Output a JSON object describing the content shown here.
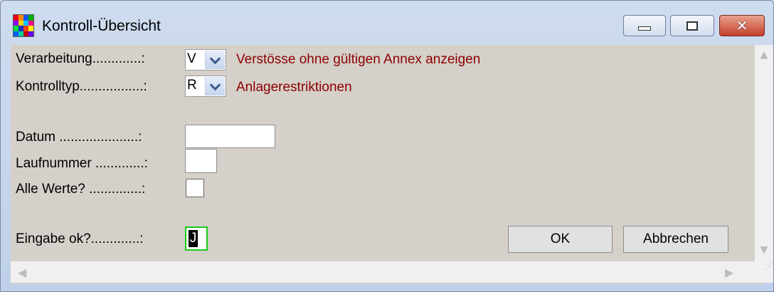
{
  "window": {
    "title": "Kontroll-Übersicht"
  },
  "title_controls": {
    "minimize": "minimize-icon",
    "maximize": "maximize-icon",
    "close": "close-icon"
  },
  "form": {
    "verarbeitung": {
      "label": "Verarbeitung.............:",
      "value": "V",
      "description": "Verstösse ohne gültigen Annex anzeigen"
    },
    "kontrolltyp": {
      "label": "Kontrolltyp.................:",
      "value": "R",
      "description": "Anlagerestriktionen"
    },
    "datum": {
      "label": "Datum .....................:",
      "value": ""
    },
    "laufnummer": {
      "label": "Laufnummer .............:",
      "value": ""
    },
    "alle_werte": {
      "label": "Alle Werte? ..............:",
      "checked": false
    },
    "eingabe_ok": {
      "label": "Eingabe ok?.............:",
      "value": "J"
    }
  },
  "buttons": {
    "ok": "OK",
    "cancel": "Abbrechen"
  },
  "colors": {
    "description_text": "#8b0000",
    "focus_border": "#1bcb1b",
    "form_bg": "#d5d0c9"
  }
}
